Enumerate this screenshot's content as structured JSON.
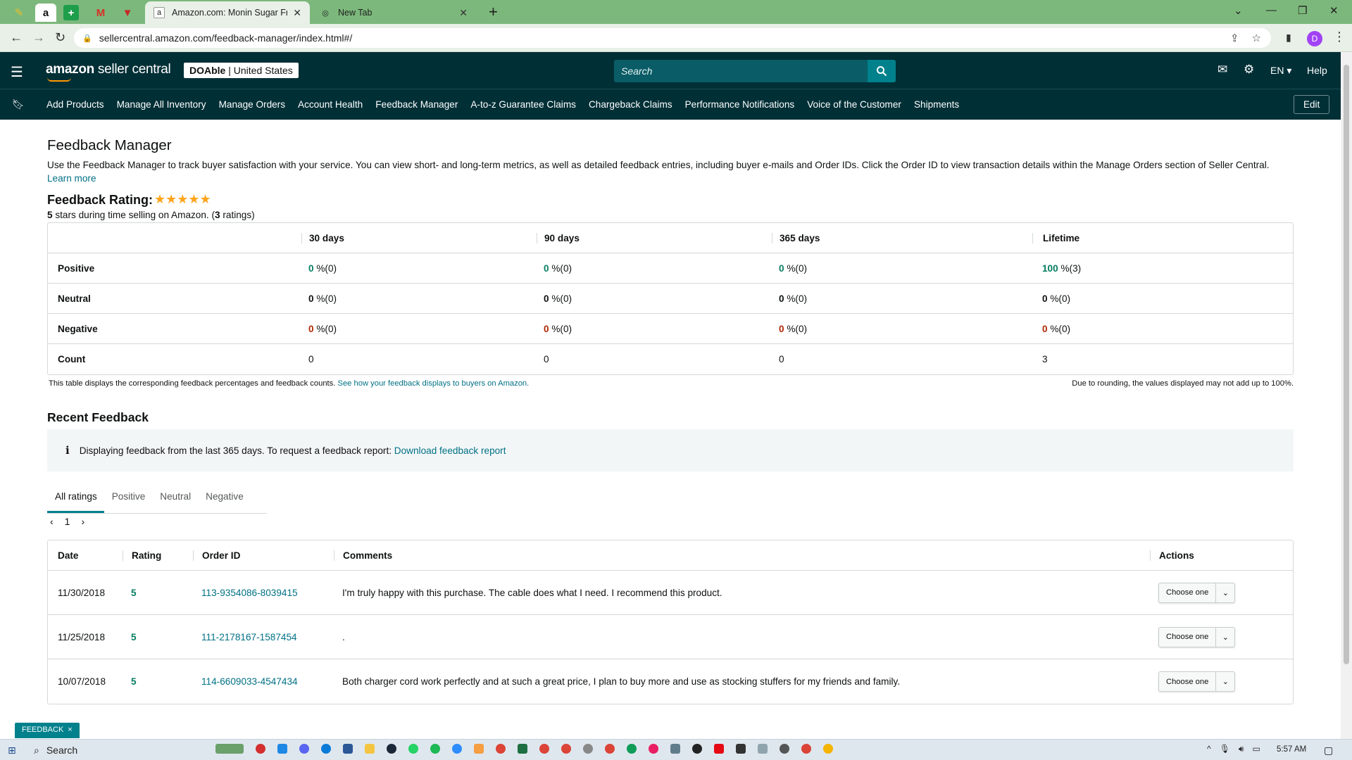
{
  "browser": {
    "tabs": [
      {
        "title": "Amazon.com: Monin Sugar Free",
        "active": true
      },
      {
        "title": "New Tab",
        "active": false
      }
    ],
    "url": "sellercentral.amazon.com/feedback-manager/index.html#/",
    "profile_initial": "D"
  },
  "header": {
    "logo_main": "amazon",
    "logo_sub": " seller central",
    "store_name": "DOAble",
    "store_region": " | United States",
    "search_placeholder": "Search",
    "language": "EN ▾",
    "help": "Help"
  },
  "nav": {
    "items": [
      "Add Products",
      "Manage All Inventory",
      "Manage Orders",
      "Account Health",
      "Feedback Manager",
      "A-to-z Guarantee Claims",
      "Chargeback Claims",
      "Performance Notifications",
      "Voice of the Customer",
      "Shipments"
    ],
    "edit": "Edit"
  },
  "page": {
    "title": "Feedback Manager",
    "description": "Use the Feedback Manager to track buyer satisfaction with your service. You can view short- and long-term metrics, as well as detailed feedback entries, including buyer e-mails and Order IDs. Click the Order ID to view transaction details within the Manage Orders section of Seller Central.",
    "learn_more": "Learn more",
    "rating_label": "Feedback Rating:",
    "stars": 5,
    "rating_stars_text": "★★★★★",
    "rating_summary_pre": "5",
    "rating_summary_mid": " stars during time selling on Amazon. (",
    "rating_summary_count": "3",
    "rating_summary_post": " ratings)"
  },
  "metrics": {
    "headers": [
      "",
      "30 days",
      "90 days",
      "365 days",
      "Lifetime"
    ],
    "rows": [
      {
        "label": "Positive",
        "cells": [
          {
            "v": "0",
            "s": " %(0)"
          },
          {
            "v": "0",
            "s": " %(0)"
          },
          {
            "v": "0",
            "s": " %(0)"
          },
          {
            "v": "100",
            "s": " %(3)"
          }
        ]
      },
      {
        "label": "Neutral",
        "cells": [
          {
            "v": "0",
            "s": " %(0)"
          },
          {
            "v": "0",
            "s": " %(0)"
          },
          {
            "v": "0",
            "s": " %(0)"
          },
          {
            "v": "0",
            "s": " %(0)"
          }
        ]
      },
      {
        "label": "Negative",
        "cells": [
          {
            "v": "0",
            "s": " %(0)"
          },
          {
            "v": "0",
            "s": " %(0)"
          },
          {
            "v": "0",
            "s": " %(0)"
          },
          {
            "v": "0",
            "s": " %(0)"
          }
        ]
      },
      {
        "label": "Count",
        "cells": [
          {
            "v": "0",
            "s": ""
          },
          {
            "v": "0",
            "s": ""
          },
          {
            "v": "0",
            "s": ""
          },
          {
            "v": "3",
            "s": ""
          }
        ]
      }
    ],
    "note_left": "This table displays the corresponding feedback percentages and feedback counts.",
    "note_left_link": "See how your feedback displays to buyers on Amazon.",
    "note_right": "Due to rounding, the values displayed may not add up to 100%."
  },
  "recent": {
    "title": "Recent Feedback",
    "info": "Displaying feedback from the last 365 days. To request a feedback report:",
    "info_link": "Download feedback report",
    "tabs": [
      "All ratings",
      "Positive",
      "Neutral",
      "Negative"
    ],
    "page": "1",
    "columns": [
      "Date",
      "Rating",
      "Order ID",
      "Comments",
      "Actions"
    ],
    "rows": [
      {
        "date": "11/30/2018",
        "rating": "5",
        "order_id": "113-9354086-8039415",
        "comment": "I'm truly happy with this purchase. The cable does what I need. I recommend this product.",
        "action": "Choose one"
      },
      {
        "date": "11/25/2018",
        "rating": "5",
        "order_id": "111-2178167-1587454",
        "comment": ".",
        "action": "Choose one"
      },
      {
        "date": "10/07/2018",
        "rating": "5",
        "order_id": "114-6609033-4547434",
        "comment": "Both charger cord work perfectly and at such a great price, I plan to buy more and use as stocking stuffers for my friends and family.",
        "action": "Choose one"
      }
    ]
  },
  "feedback_pill": {
    "label": "FEEDBACK",
    "close": "×"
  },
  "taskbar": {
    "search": "Search",
    "time": "5:57 AM"
  },
  "colors": {
    "header_bg": "#002f36",
    "positive": "#067d62",
    "negative": "#b12704",
    "link": "#007185",
    "tab_green": "#7cb87c"
  }
}
